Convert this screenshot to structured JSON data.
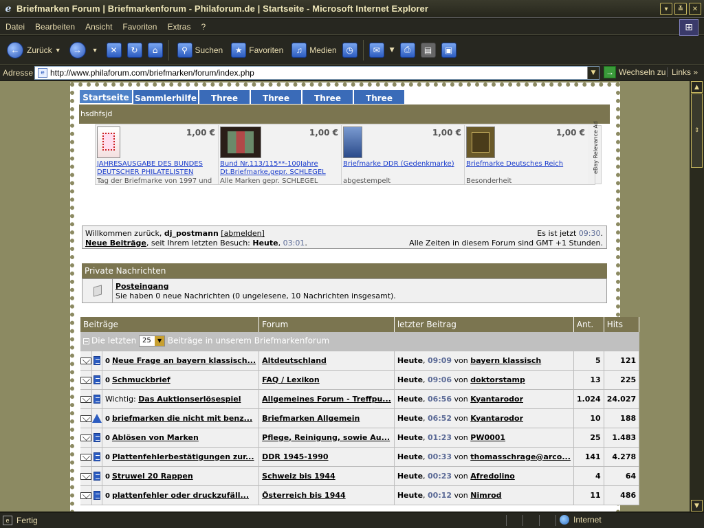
{
  "window": {
    "title": "Briefmarken Forum | Briefmarkenforum - Philaforum.de | Startseite - Microsoft Internet Explorer"
  },
  "menu": [
    "Datei",
    "Bearbeiten",
    "Ansicht",
    "Favoriten",
    "Extras",
    "?"
  ],
  "toolbar": {
    "back": "Zurück",
    "search": "Suchen",
    "favorites": "Favoriten",
    "media": "Medien"
  },
  "address": {
    "label": "Adresse",
    "url": "http://www.philaforum.com/briefmarken/forum/index.php",
    "go": "Wechseln zu",
    "links": "Links"
  },
  "tabs": [
    "Startseite",
    "Sammlerhilfe",
    "Three",
    "Three",
    "Three",
    "Three"
  ],
  "sitebar": "hsdhfsjd",
  "ebay": {
    "items": [
      {
        "price": "1,00 €",
        "title": "JAHRESAUSGABE DES BUNDES DEUTSCHER PHILATELISTEN",
        "sub": "Tag der Briefmarke von 1997 und"
      },
      {
        "price": "1,00 €",
        "title": "Bund Nr.113/115**-100Jahre Dt.Briefmarke,gepr. SCHLEGEL",
        "sub": "Alle Marken gepr. SCHLEGEL"
      },
      {
        "price": "1,00 €",
        "title": "Briefmarke DDR (Gedenkmarke)",
        "sub": "abgestempelt"
      },
      {
        "price": "1,00 €",
        "title": "Briefmarke Deutsches Reich",
        "sub": "Besonderheit"
      }
    ],
    "adlabel": "eBay Relevance Ad"
  },
  "welcome": {
    "prefix": "Willkommen zurück, ",
    "user": "dj_postmann",
    "logout": "[abmelden]",
    "newposts": "Neue Beiträge",
    "since": ", seit Ihrem letzten Besuch: ",
    "today": "Heute",
    "comma": ", ",
    "lasttime": "03:01",
    "dot": ".",
    "now_prefix": "Es ist jetzt ",
    "now": "09:30",
    "now_dot": ".",
    "tz": "Alle Zeiten in diesem Forum sind GMT +1 Stunden."
  },
  "pm": {
    "header": "Private Nachrichten",
    "inbox": "Posteingang",
    "info": "Sie haben 0 neue Nachrichten (0 ungelesene, 10 Nachrichten insgesamt)."
  },
  "posts": {
    "headers": [
      "Beiträge",
      "Forum",
      "letzter Beitrag",
      "Ant.",
      "Hits"
    ],
    "sub_prefix": "Die letzten",
    "count": "25",
    "sub_suffix": "Beiträge in unserem Briefmarkenforum",
    "rows": [
      {
        "icon2": "doc",
        "prefix": "",
        "title": "Neue Frage an bayern klassisch...",
        "forum": "Altdeutschland",
        "day": "Heute",
        "time": "09:09",
        "by": "von",
        "user": "bayern klassisch",
        "replies": "5",
        "hits": "121"
      },
      {
        "icon2": "doc",
        "prefix": "",
        "title": "Schmuckbrief",
        "forum": "FAQ / Lexikon",
        "day": "Heute",
        "time": "09:06",
        "by": "von",
        "user": "doktorstamp",
        "replies": "13",
        "hits": "225"
      },
      {
        "icon2": "doc",
        "prefix": "Wichtig: ",
        "title": "Das Auktionserlösespiel",
        "forum": "Allgemeines Forum - Treffpu...",
        "day": "Heute",
        "time": "06:56",
        "by": "von",
        "user": "Kyantarodor",
        "replies": "1.024",
        "hits": "24.027"
      },
      {
        "icon2": "warn",
        "prefix": "",
        "title": "briefmarken die nicht mit benz...",
        "forum": "Briefmarken Allgemein",
        "day": "Heute",
        "time": "06:52",
        "by": "von",
        "user": "Kyantarodor",
        "replies": "10",
        "hits": "188"
      },
      {
        "icon2": "doc",
        "prefix": "",
        "title": "Ablösen von Marken",
        "forum": "Pflege, Reinigung, sowie Au...",
        "day": "Heute",
        "time": "01:23",
        "by": "von",
        "user": "PW0001",
        "replies": "25",
        "hits": "1.483"
      },
      {
        "icon2": "doc",
        "prefix": "",
        "title": "Plattenfehlerbestätigungen zur...",
        "forum": "DDR 1945-1990",
        "day": "Heute",
        "time": "00:33",
        "by": "von",
        "user": "thomasschrage@arco...",
        "replies": "141",
        "hits": "4.278"
      },
      {
        "icon2": "doc",
        "prefix": "",
        "title": "Struwel 20 Rappen",
        "forum": "Schweiz bis 1944",
        "day": "Heute",
        "time": "00:23",
        "by": "von",
        "user": "Afredolino",
        "replies": "4",
        "hits": "64"
      },
      {
        "icon2": "doc",
        "prefix": "",
        "title": "plattenfehler oder druckzufäll...",
        "forum": "Österreich bis 1944",
        "day": "Heute",
        "time": "00:12",
        "by": "von",
        "user": "Nimrod",
        "replies": "11",
        "hits": "486"
      }
    ]
  },
  "status": {
    "text": "Fertig",
    "zone": "Internet"
  }
}
